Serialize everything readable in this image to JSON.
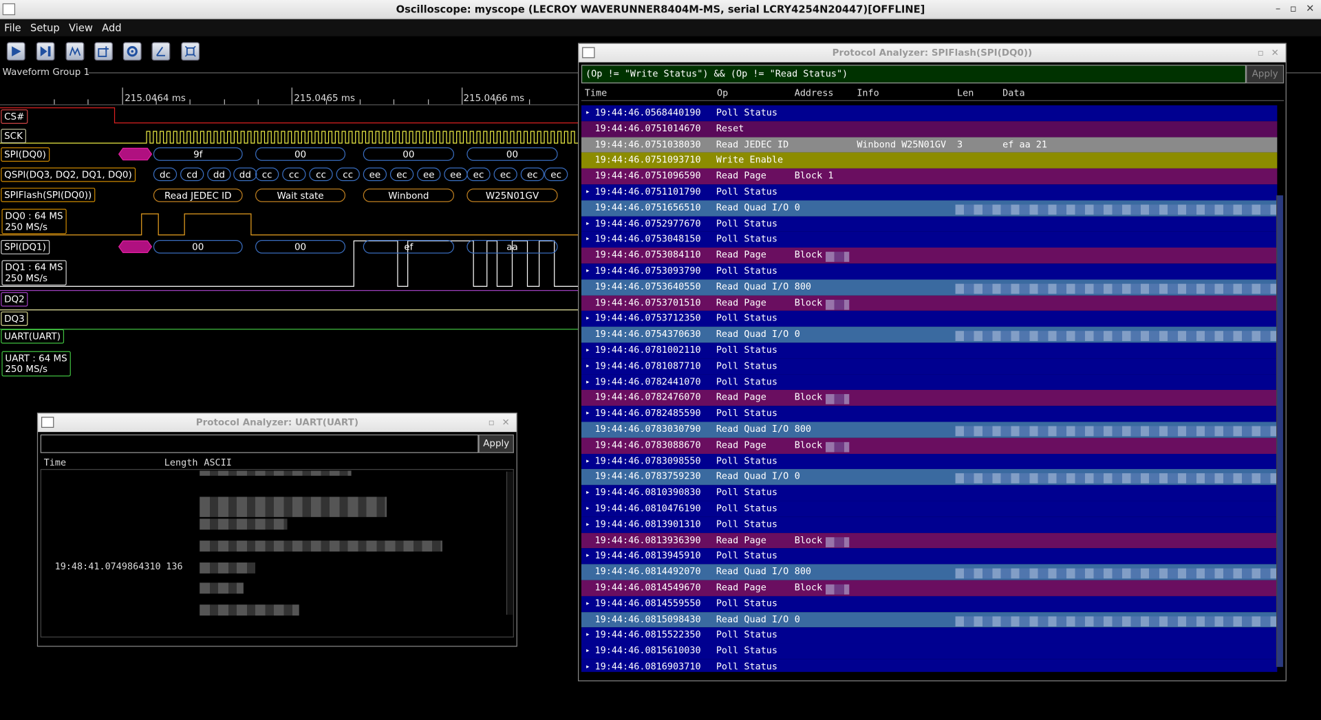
{
  "window": {
    "title": "Oscilloscope: myscope (LECROY WAVERUNNER8404M-MS, serial LCRY4254N20447)[OFFLINE]"
  },
  "menu": [
    "File",
    "Setup",
    "View",
    "Add"
  ],
  "toolbar": [
    "play-icon",
    "step-icon",
    "trigger-icon",
    "add-channel-icon",
    "settings-icon",
    "measure-icon",
    "zoom-fit-icon"
  ],
  "waveform_group": {
    "label": "Waveform Group 1",
    "ticks": [
      "215.0464 ms",
      "215.0465 ms",
      "215.0466 ms"
    ],
    "channels": {
      "cs": "CS#",
      "sck": "SCK",
      "spi_dq0": "SPI(DQ0)",
      "qspi": "QSPI(DQ3, DQ2, DQ1, DQ0)",
      "spiflash": "SPIFlash(SPI(DQ0))",
      "dq0_rate": "DQ0 : 64 MS",
      "dq0_srate": "250 MS/s",
      "spi_dq1": "SPI(DQ1)",
      "dq1_rate": "DQ1 : 64 MS",
      "dq1_srate": "250 MS/s",
      "dq2": "DQ2",
      "dq3": "DQ3",
      "uart": "UART(UART)",
      "uart_rate": "UART : 64 MS",
      "uart_srate": "250 MS/s"
    },
    "dq0_bytes": [
      "9f",
      "00",
      "00",
      "00"
    ],
    "qspi_nibbles": [
      "dc",
      "cd",
      "dd",
      "dd",
      "cc",
      "cc",
      "cc",
      "cc",
      "ee",
      "ec",
      "ee",
      "ee",
      "ec",
      "ec",
      "ec",
      "ec"
    ],
    "spiflash_labels": [
      "Read JEDEC ID",
      "Wait state",
      "Winbond",
      "W25N01GV"
    ],
    "dq1_bytes": [
      "00",
      "00",
      "ef",
      "aa"
    ]
  },
  "spi_analyzer": {
    "title": "Protocol Analyzer: SPIFlash(SPI(DQ0))",
    "filter": "(Op != \"Write Status\") && (Op != \"Read Status\")",
    "apply": "Apply",
    "columns": [
      "Time",
      "Op",
      "Address",
      "Info",
      "Len",
      "Data"
    ],
    "rows": [
      {
        "time": "19:44:46.0568440190",
        "op": "Poll Status",
        "addr": "",
        "info": "",
        "len": "",
        "data": "",
        "exp": true,
        "kind": "poll"
      },
      {
        "time": "19:44:46.0751014670",
        "op": "Reset",
        "addr": "",
        "info": "",
        "len": "",
        "data": "",
        "exp": false,
        "kind": "reset"
      },
      {
        "time": "19:44:46.0751038030",
        "op": "Read JEDEC ID",
        "addr": "",
        "info": "Winbond W25N01GV",
        "len": "3",
        "data": "ef aa 21",
        "exp": false,
        "kind": "jedec"
      },
      {
        "time": "19:44:46.0751093710",
        "op": "Write Enable",
        "addr": "",
        "info": "",
        "len": "",
        "data": "",
        "exp": false,
        "kind": "wren"
      },
      {
        "time": "19:44:46.0751096590",
        "op": "Read Page",
        "addr": "Block 1",
        "info": "",
        "len": "",
        "data": "",
        "exp": false,
        "kind": "page"
      },
      {
        "time": "19:44:46.0751101790",
        "op": "Poll Status",
        "addr": "",
        "info": "",
        "len": "",
        "data": "",
        "exp": true,
        "kind": "poll"
      },
      {
        "time": "19:44:46.0751656510",
        "op": "Read Quad I/O",
        "addr": "0",
        "info": "",
        "len": "",
        "data": "",
        "exp": false,
        "kind": "quad"
      },
      {
        "time": "19:44:46.0752977670",
        "op": "Poll Status",
        "addr": "",
        "info": "",
        "len": "",
        "data": "",
        "exp": true,
        "kind": "poll"
      },
      {
        "time": "19:44:46.0753048150",
        "op": "Poll Status",
        "addr": "",
        "info": "",
        "len": "",
        "data": "",
        "exp": true,
        "kind": "poll"
      },
      {
        "time": "19:44:46.0753084110",
        "op": "Read Page",
        "addr": "Block",
        "info": "",
        "len": "",
        "data": "",
        "exp": false,
        "kind": "page"
      },
      {
        "time": "19:44:46.0753093790",
        "op": "Poll Status",
        "addr": "",
        "info": "",
        "len": "",
        "data": "",
        "exp": true,
        "kind": "poll"
      },
      {
        "time": "19:44:46.0753640550",
        "op": "Read Quad I/O",
        "addr": "800",
        "info": "",
        "len": "",
        "data": "",
        "exp": false,
        "kind": "quad"
      },
      {
        "time": "19:44:46.0753701510",
        "op": "Read Page",
        "addr": "Block",
        "info": "",
        "len": "",
        "data": "",
        "exp": false,
        "kind": "page"
      },
      {
        "time": "19:44:46.0753712350",
        "op": "Poll Status",
        "addr": "",
        "info": "",
        "len": "",
        "data": "",
        "exp": true,
        "kind": "poll"
      },
      {
        "time": "19:44:46.0754370630",
        "op": "Read Quad I/O",
        "addr": "0",
        "info": "",
        "len": "",
        "data": "",
        "exp": false,
        "kind": "quad"
      },
      {
        "time": "19:44:46.0781002110",
        "op": "Poll Status",
        "addr": "",
        "info": "",
        "len": "",
        "data": "",
        "exp": true,
        "kind": "poll"
      },
      {
        "time": "19:44:46.0781087710",
        "op": "Poll Status",
        "addr": "",
        "info": "",
        "len": "",
        "data": "",
        "exp": true,
        "kind": "poll"
      },
      {
        "time": "19:44:46.0782441070",
        "op": "Poll Status",
        "addr": "",
        "info": "",
        "len": "",
        "data": "",
        "exp": true,
        "kind": "poll"
      },
      {
        "time": "19:44:46.0782476070",
        "op": "Read Page",
        "addr": "Block",
        "info": "",
        "len": "",
        "data": "",
        "exp": false,
        "kind": "page"
      },
      {
        "time": "19:44:46.0782485590",
        "op": "Poll Status",
        "addr": "",
        "info": "",
        "len": "",
        "data": "",
        "exp": true,
        "kind": "poll"
      },
      {
        "time": "19:44:46.0783030790",
        "op": "Read Quad I/O",
        "addr": "800",
        "info": "",
        "len": "",
        "data": "",
        "exp": false,
        "kind": "quad"
      },
      {
        "time": "19:44:46.0783088670",
        "op": "Read Page",
        "addr": "Block",
        "info": "",
        "len": "",
        "data": "",
        "exp": false,
        "kind": "page"
      },
      {
        "time": "19:44:46.0783098550",
        "op": "Poll Status",
        "addr": "",
        "info": "",
        "len": "",
        "data": "",
        "exp": true,
        "kind": "poll"
      },
      {
        "time": "19:44:46.0783759230",
        "op": "Read Quad I/O",
        "addr": "0",
        "info": "",
        "len": "",
        "data": "",
        "exp": false,
        "kind": "quad"
      },
      {
        "time": "19:44:46.0810390830",
        "op": "Poll Status",
        "addr": "",
        "info": "",
        "len": "",
        "data": "",
        "exp": true,
        "kind": "poll"
      },
      {
        "time": "19:44:46.0810476190",
        "op": "Poll Status",
        "addr": "",
        "info": "",
        "len": "",
        "data": "",
        "exp": true,
        "kind": "poll"
      },
      {
        "time": "19:44:46.0813901310",
        "op": "Poll Status",
        "addr": "",
        "info": "",
        "len": "",
        "data": "",
        "exp": true,
        "kind": "poll"
      },
      {
        "time": "19:44:46.0813936390",
        "op": "Read Page",
        "addr": "Block",
        "info": "",
        "len": "",
        "data": "",
        "exp": false,
        "kind": "page"
      },
      {
        "time": "19:44:46.0813945910",
        "op": "Poll Status",
        "addr": "",
        "info": "",
        "len": "",
        "data": "",
        "exp": true,
        "kind": "poll"
      },
      {
        "time": "19:44:46.0814492070",
        "op": "Read Quad I/O",
        "addr": "800",
        "info": "",
        "len": "",
        "data": "",
        "exp": false,
        "kind": "quad"
      },
      {
        "time": "19:44:46.0814549670",
        "op": "Read Page",
        "addr": "Block",
        "info": "",
        "len": "",
        "data": "",
        "exp": false,
        "kind": "page"
      },
      {
        "time": "19:44:46.0814559550",
        "op": "Poll Status",
        "addr": "",
        "info": "",
        "len": "",
        "data": "",
        "exp": true,
        "kind": "poll"
      },
      {
        "time": "19:44:46.0815098430",
        "op": "Read Quad I/O",
        "addr": "0",
        "info": "",
        "len": "",
        "data": "",
        "exp": false,
        "kind": "quad"
      },
      {
        "time": "19:44:46.0815522350",
        "op": "Poll Status",
        "addr": "",
        "info": "",
        "len": "",
        "data": "",
        "exp": true,
        "kind": "poll"
      },
      {
        "time": "19:44:46.0815610030",
        "op": "Poll Status",
        "addr": "",
        "info": "",
        "len": "",
        "data": "",
        "exp": true,
        "kind": "poll"
      },
      {
        "time": "19:44:46.0816903710",
        "op": "Poll Status",
        "addr": "",
        "info": "",
        "len": "",
        "data": "",
        "exp": true,
        "kind": "poll"
      }
    ],
    "colors": {
      "poll": "#000090",
      "reset": "#5a0a5a",
      "jedec": "#8a8a8a",
      "wren": "#8c8c00",
      "page": "#6a0e60",
      "quad": "#3a6aa0"
    }
  },
  "uart_analyzer": {
    "title": "Protocol Analyzer: UART(UART)",
    "filter": "",
    "apply": "Apply",
    "columns": [
      "Time",
      "Length",
      "ASCII"
    ],
    "row": {
      "time": "19:48:41.0749864310",
      "len": "136"
    }
  }
}
